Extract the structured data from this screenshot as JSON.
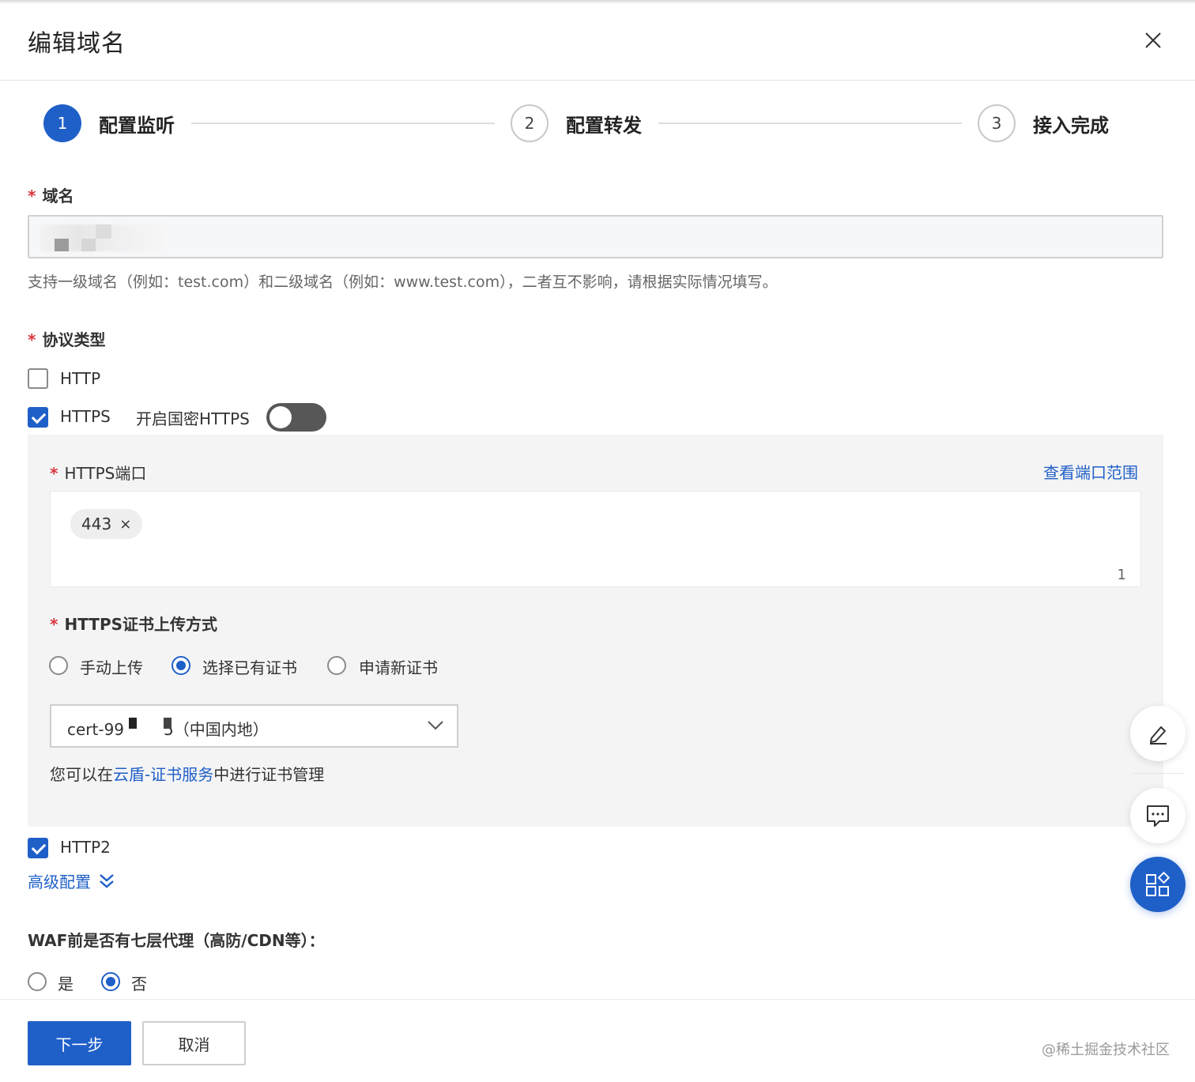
{
  "dialog": {
    "title": "编辑域名"
  },
  "steps": [
    {
      "number": "1",
      "label": "配置监听"
    },
    {
      "number": "2",
      "label": "配置转发"
    },
    {
      "number": "3",
      "label": "接入完成"
    }
  ],
  "domain": {
    "label": "域名",
    "hint": "支持一级域名（例如：test.com）和二级域名（例如：www.test.com），二者互不影响，请根据实际情况填写。"
  },
  "protocol": {
    "label": "协议类型",
    "http_label": "HTTP",
    "https_label": "HTTPS",
    "gm_https_label": "开启国密HTTPS"
  },
  "https_port": {
    "label": "HTTPS端口",
    "link": "查看端口范围",
    "tag": "443",
    "tag_close": "×",
    "count": "1"
  },
  "cert": {
    "label": "HTTPS证书上传方式",
    "options": [
      "手动上传",
      "选择已有证书",
      "申请新证书"
    ],
    "selected_value": "cert-99",
    "selected_suffix": "5（中国内地）",
    "manage_prefix": "您可以在",
    "manage_link": "云盾-证书服务",
    "manage_suffix": "中进行证书管理"
  },
  "http2": {
    "label": "HTTP2"
  },
  "advanced": {
    "label": "高级配置"
  },
  "proxy": {
    "label": "WAF前是否有七层代理（高防/CDN等）：",
    "yes": "是",
    "no": "否"
  },
  "footer": {
    "next": "下一步",
    "cancel": "取消",
    "watermark": "@稀土掘金技术社区"
  },
  "colors": {
    "primary": "#1f5fc8",
    "required": "#d9363e"
  },
  "icons": [
    "close-icon",
    "check-icon",
    "chevron-down-icon",
    "double-chevron-down-icon",
    "edit-icon",
    "chat-icon",
    "apps-icon"
  ]
}
